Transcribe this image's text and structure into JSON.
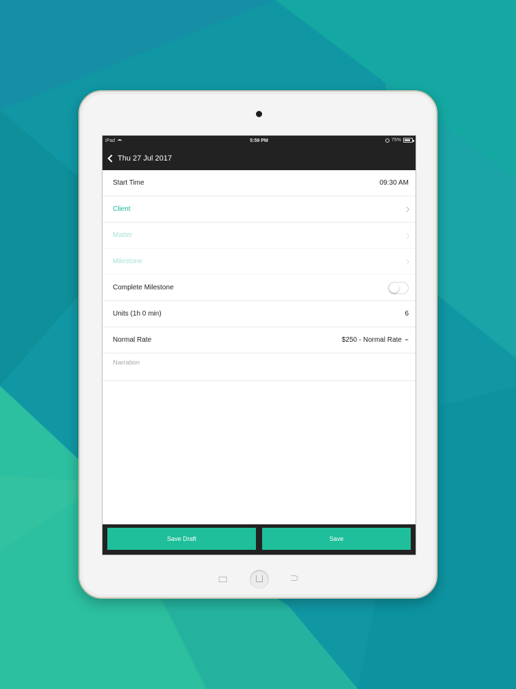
{
  "status_bar": {
    "carrier": "iPad",
    "time": "5:59 PM",
    "battery": "75%",
    "battery_level": 0.75
  },
  "nav": {
    "back_title": "Thu 27 Jul 2017"
  },
  "form": {
    "start_time": {
      "label": "Start Time",
      "value": "09:30 AM"
    },
    "client": {
      "label": "Client"
    },
    "matter": {
      "label": "Matter"
    },
    "milestone": {
      "label": "Milestone"
    },
    "complete_milestone": {
      "label": "Complete Milestone",
      "enabled": false
    },
    "units": {
      "label": "Units (1h 0 min)",
      "value": "6"
    },
    "rate": {
      "label": "Normal Rate",
      "value": "$250 - Normal Rate"
    },
    "narration": {
      "placeholder": "Narration",
      "value": ""
    }
  },
  "actions": {
    "save_draft": "Save Draft",
    "save": "Save"
  },
  "colors": {
    "accent": "#1fbf9b",
    "bar": "#222222",
    "background": "#0f9aa0"
  }
}
